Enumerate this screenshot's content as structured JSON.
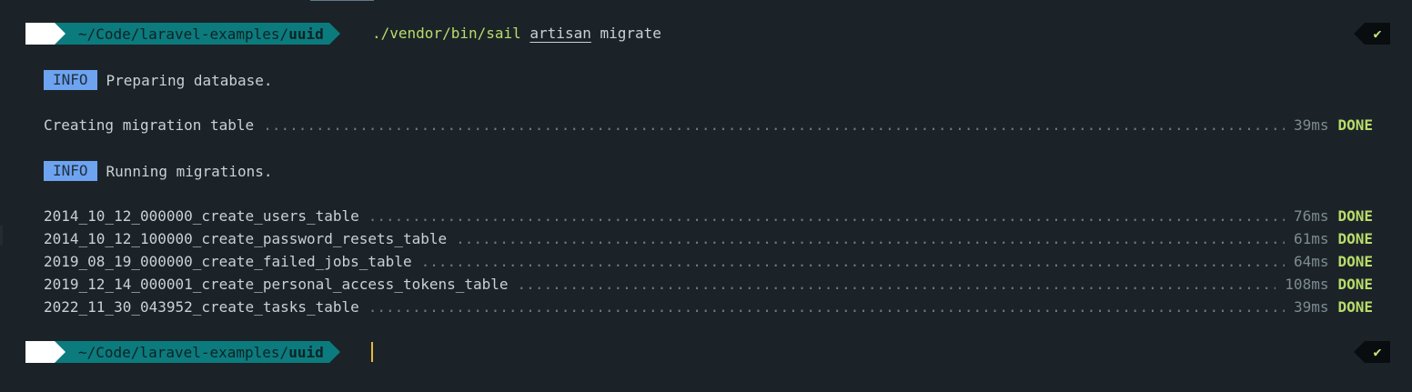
{
  "prompt": {
    "os_icon": "",
    "folder_icon": "",
    "path_prefix": "~/Code/laravel-examples/",
    "path_base": "uuid"
  },
  "command": {
    "executable": "./vendor/bin/sail",
    "arg1": "artisan",
    "arg2": "migrate"
  },
  "status": {
    "symbol": "✔"
  },
  "output": {
    "info_label": "INFO",
    "info1": "Preparing database.",
    "info2": "Running migrations.",
    "setup": {
      "name": "Creating migration table",
      "time": "39ms",
      "status": "DONE"
    },
    "migrations": [
      {
        "name": "2014_10_12_000000_create_users_table",
        "time": "76ms",
        "status": "DONE"
      },
      {
        "name": "2014_10_12_100000_create_password_resets_table",
        "time": "61ms",
        "status": "DONE"
      },
      {
        "name": "2019_08_19_000000_create_failed_jobs_table",
        "time": "64ms",
        "status": "DONE"
      },
      {
        "name": "2019_12_14_000001_create_personal_access_tokens_table",
        "time": "108ms",
        "status": "DONE"
      },
      {
        "name": "2022_11_30_043952_create_tasks_table",
        "time": "39ms",
        "status": "DONE"
      }
    ]
  },
  "colors": {
    "background": "#1b2328",
    "prompt_teal": "#0b7b7d",
    "info_badge": "#6ea3f0",
    "done_green": "#b9dc6a",
    "cursor": "#e5b93a"
  }
}
